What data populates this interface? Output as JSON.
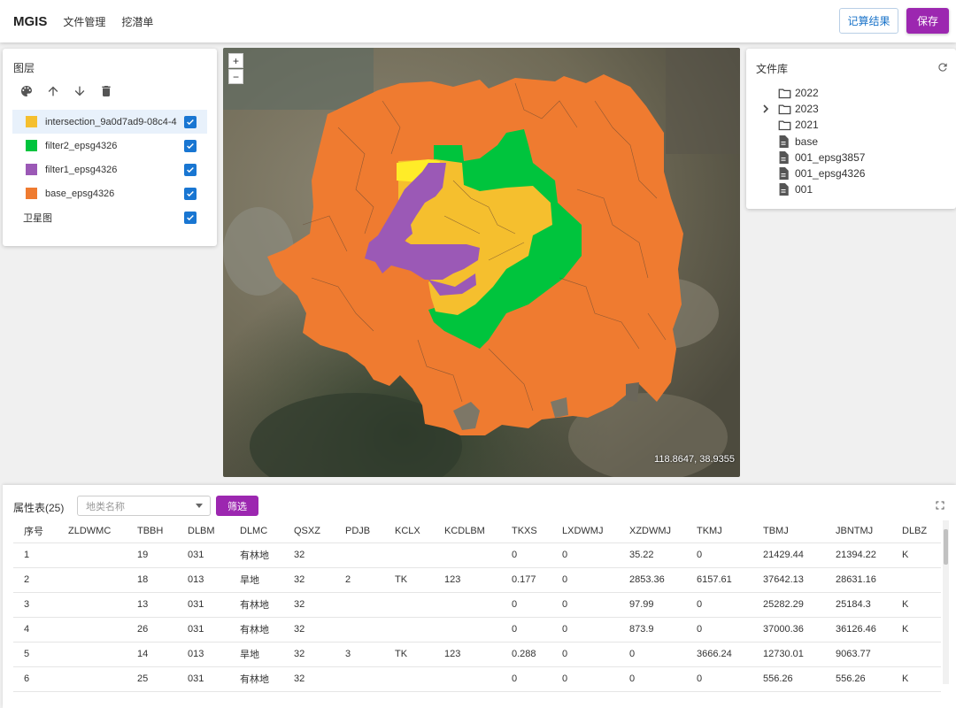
{
  "header": {
    "brand": "MGIS",
    "nav": [
      "文件管理",
      "挖潜单"
    ],
    "record_button": "记算结果",
    "save_button": "保存"
  },
  "layers": {
    "title": "图层",
    "tools": [
      "palette-icon",
      "arrow-up-icon",
      "arrow-down-icon",
      "delete-icon"
    ],
    "items": [
      {
        "name": "intersection_9a0d7ad9-08c4-4",
        "color": "#f5bf2e",
        "checked": true,
        "active": true
      },
      {
        "name": "filter2_epsg4326",
        "color": "#00c43d",
        "checked": true,
        "active": false
      },
      {
        "name": "filter1_epsg4326",
        "color": "#9b59b6",
        "checked": true,
        "active": false
      },
      {
        "name": "base_epsg4326",
        "color": "#ef7b30",
        "checked": true,
        "active": false
      }
    ],
    "basemap": {
      "name": "卫星图",
      "checked": true
    }
  },
  "map": {
    "zoom_in": "+",
    "zoom_out": "−",
    "coordinates": "118.8647, 38.9355"
  },
  "file_library": {
    "title": "文件库",
    "items": [
      {
        "label": "2022",
        "type": "folder",
        "expandable": false
      },
      {
        "label": "2023",
        "type": "folder",
        "expandable": true
      },
      {
        "label": "2021",
        "type": "folder",
        "expandable": false
      },
      {
        "label": "base",
        "type": "file",
        "expandable": false
      },
      {
        "label": "001_epsg3857",
        "type": "file",
        "expandable": false
      },
      {
        "label": "001_epsg4326",
        "type": "file",
        "expandable": false
      },
      {
        "label": "001",
        "type": "file",
        "expandable": false
      }
    ]
  },
  "attribute_table": {
    "title": "属性表(25)",
    "select_placeholder": "地类名称",
    "filter_button": "筛选",
    "columns": [
      "序号",
      "ZLDWMC",
      "TBBH",
      "DLBM",
      "DLMC",
      "QSXZ",
      "PDJB",
      "KCLX",
      "KCDLBM",
      "TKXS",
      "LXDWMJ",
      "XZDWMJ",
      "TKMJ",
      "TBMJ",
      "JBNTMJ",
      "DLBZ"
    ],
    "rows": [
      [
        "1",
        "",
        "19",
        "031",
        "有林地",
        "32",
        "",
        "",
        "",
        "0",
        "0",
        "35.22",
        "0",
        "21429.44",
        "21394.22",
        "K"
      ],
      [
        "2",
        "",
        "18",
        "013",
        "旱地",
        "32",
        "2",
        "TK",
        "123",
        "0.177",
        "0",
        "2853.36",
        "6157.61",
        "37642.13",
        "28631.16",
        ""
      ],
      [
        "3",
        "",
        "13",
        "031",
        "有林地",
        "32",
        "",
        "",
        "",
        "0",
        "0",
        "97.99",
        "0",
        "25282.29",
        "25184.3",
        "K"
      ],
      [
        "4",
        "",
        "26",
        "031",
        "有林地",
        "32",
        "",
        "",
        "",
        "0",
        "0",
        "873.9",
        "0",
        "37000.36",
        "36126.46",
        "K"
      ],
      [
        "5",
        "",
        "14",
        "013",
        "旱地",
        "32",
        "3",
        "TK",
        "123",
        "0.288",
        "0",
        "0",
        "3666.24",
        "12730.01",
        "9063.77",
        ""
      ],
      [
        "6",
        "",
        "25",
        "031",
        "有林地",
        "32",
        "",
        "",
        "",
        "0",
        "0",
        "0",
        "0",
        "556.26",
        "556.26",
        "K"
      ]
    ]
  }
}
